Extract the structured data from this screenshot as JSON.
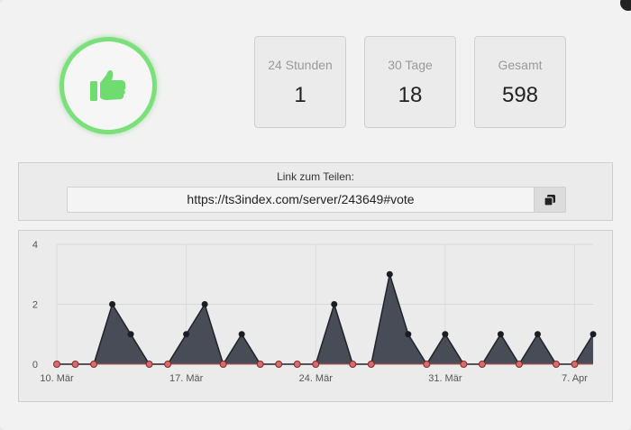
{
  "stats": [
    {
      "label": "24 Stunden",
      "value": "1"
    },
    {
      "label": "30 Tage",
      "value": "18"
    },
    {
      "label": "Gesamt",
      "value": "598"
    }
  ],
  "share": {
    "title": "Link zum Teilen:",
    "url": "https://ts3index.com/server/243649#vote"
  },
  "icons": {
    "thumb": "thumbs-up-icon",
    "copy": "copy-icon",
    "close": "close-icon"
  },
  "colors": {
    "accent_green": "#7be07b",
    "area_fill": "#474c57",
    "zero_point": "#d96b6b"
  },
  "chart_data": {
    "type": "area",
    "ylim": [
      0,
      4
    ],
    "yticks": [
      0,
      2,
      4
    ],
    "xtick_labels": [
      "10. Mär",
      "17. Mär",
      "24. Mär",
      "31. Mär",
      "7. Apr"
    ],
    "xtick_index": [
      0,
      7,
      14,
      21,
      28
    ],
    "x": [
      "10. Mär",
      "11. Mär",
      "12. Mär",
      "13. Mär",
      "14. Mär",
      "15. Mär",
      "16. Mär",
      "17. Mär",
      "18. Mär",
      "19. Mär",
      "20. Mär",
      "21. Mär",
      "22. Mär",
      "23. Mär",
      "24. Mär",
      "25. Mär",
      "26. Mär",
      "27. Mär",
      "28. Mär",
      "29. Mär",
      "30. Mär",
      "31. Mär",
      "1. Apr",
      "2. Apr",
      "3. Apr",
      "4. Apr",
      "5. Apr",
      "6. Apr",
      "7. Apr",
      "8. Apr"
    ],
    "values": [
      0,
      0,
      0,
      2,
      1,
      0,
      0,
      1,
      2,
      0,
      1,
      0,
      0,
      0,
      0,
      2,
      0,
      0,
      3,
      1,
      0,
      1,
      0,
      0,
      1,
      0,
      1,
      0,
      0,
      1
    ]
  }
}
